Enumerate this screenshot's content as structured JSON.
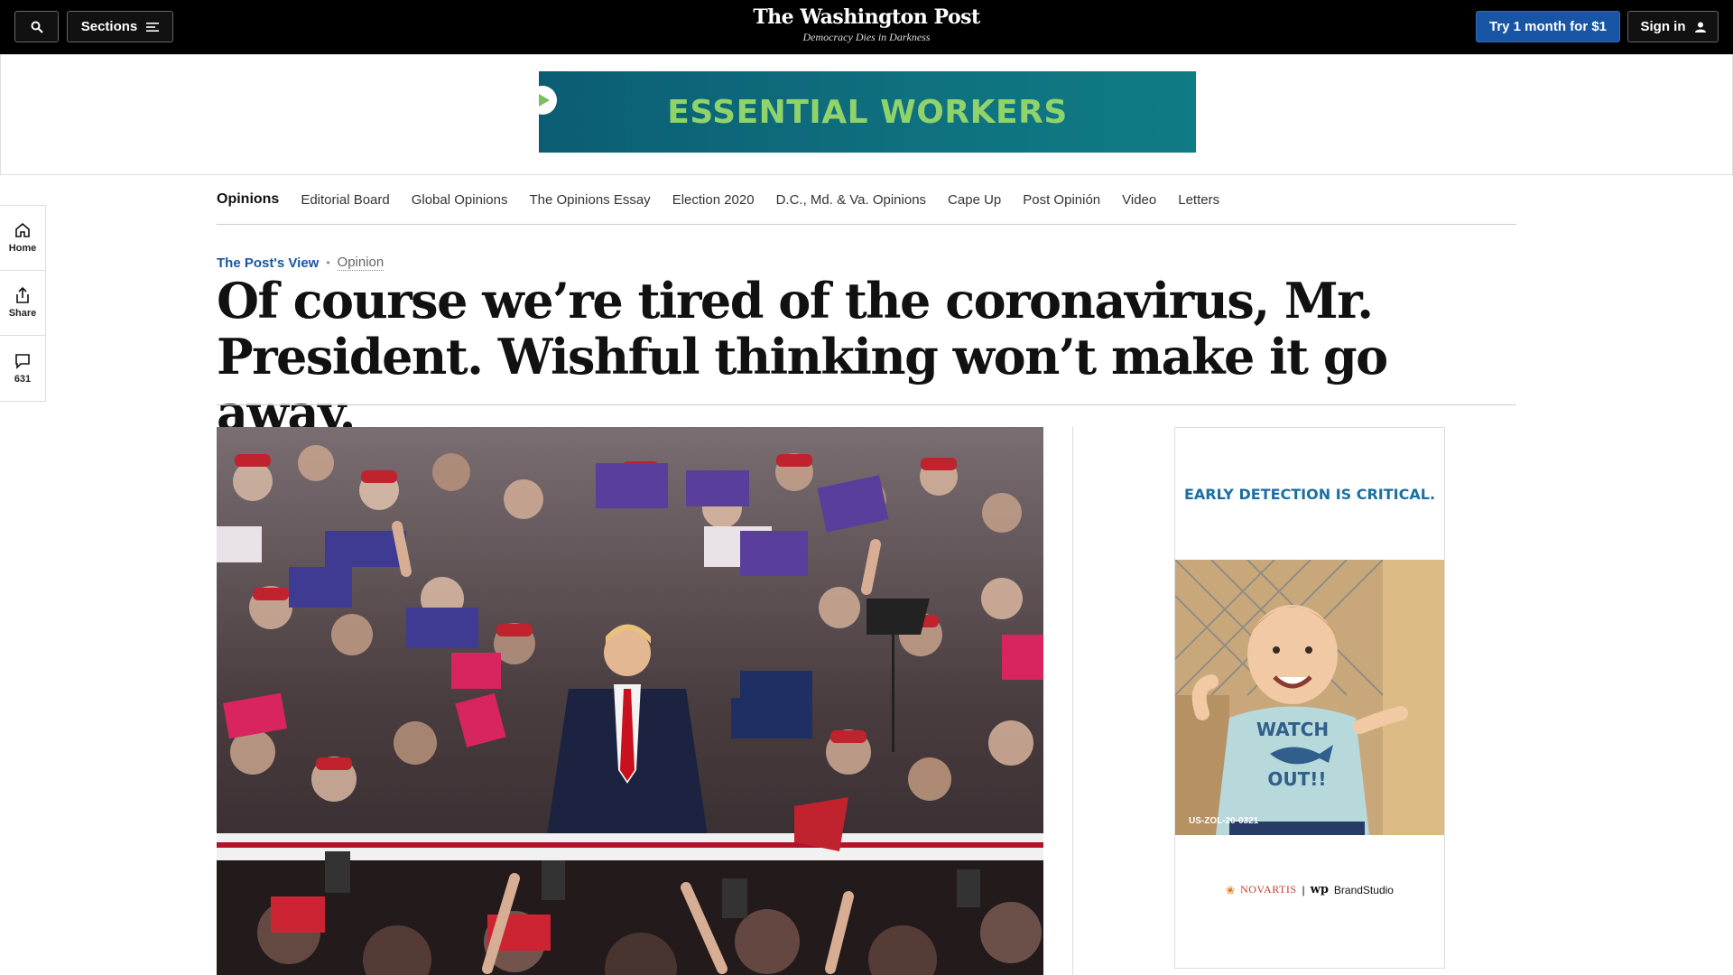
{
  "header": {
    "sections_label": "Sections",
    "logo_title": "The Washington Post",
    "logo_tagline": "Democracy Dies in Darkness",
    "try_label": "Try 1 month for $1",
    "signin_label": "Sign in"
  },
  "ad_banner": {
    "text": "ESSENTIAL WORKERS"
  },
  "rail": {
    "home_label": "Home",
    "share_label": "Share",
    "comments_count": "631"
  },
  "opinions_nav": {
    "brand": "Opinions",
    "links": [
      "Editorial Board",
      "Global Opinions",
      "The Opinions Essay",
      "Election 2020",
      "D.C., Md. & Va. Opinions",
      "Cape Up",
      "Post Opinión",
      "Video",
      "Letters"
    ]
  },
  "article": {
    "kicker": "The Post's View",
    "section": "Opinion",
    "headline": "Of course we’re tired of the coronavirus, Mr. President. Wishful thinking won’t make it go away."
  },
  "right_ad": {
    "title": "EARLY DETECTION IS CRITICAL.",
    "shirt_text_1": "WATCH",
    "shirt_text_2": "OUT!!",
    "code": "US-ZOL-20-0321",
    "sponsor": "NOVARTIS",
    "brand": "BrandStudio"
  },
  "colors": {
    "topbar_bg": "#000000",
    "accent_blue": "#1955a5",
    "ad_banner_text": "#8fd36a",
    "ad_banner_bg": "#0f7180",
    "right_ad_title": "#1a6fa3"
  },
  "icons": [
    "search-icon",
    "hamburger-icon",
    "user-icon",
    "home-icon",
    "share-icon",
    "comment-icon",
    "play-icon"
  ]
}
